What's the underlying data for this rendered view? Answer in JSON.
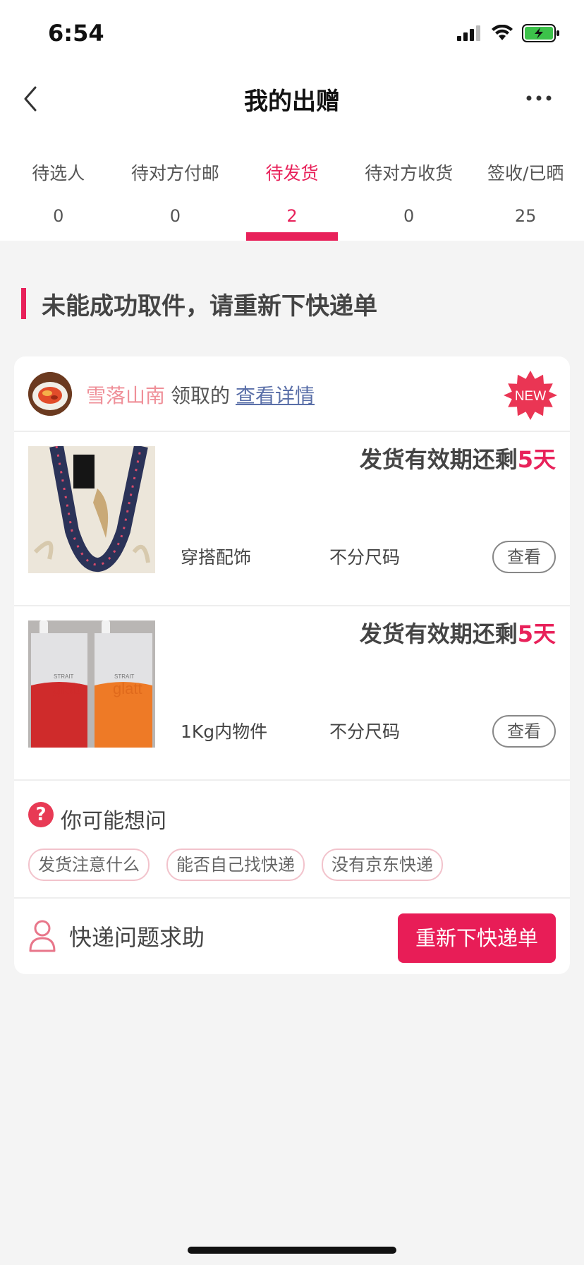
{
  "status_bar": {
    "time": "6:54"
  },
  "header": {
    "title": "我的出赠"
  },
  "tabs": [
    {
      "label": "待选人",
      "count": "0"
    },
    {
      "label": "待对方付邮",
      "count": "0"
    },
    {
      "label": "待发货",
      "count": "2"
    },
    {
      "label": "待对方收货",
      "count": "0"
    },
    {
      "label": "签收/已晒",
      "count": "25"
    }
  ],
  "active_tab_index": 2,
  "notice": {
    "text": "未能成功取件，请重新下快递单"
  },
  "claimer": {
    "name": "雪落山南",
    "action": "领取的",
    "link": "查看详情",
    "badge": "NEW"
  },
  "items": [
    {
      "deadline_prefix": "发货有效期还剩",
      "deadline_value": "5天",
      "category": "穿搭配饰",
      "size": "不分尺码",
      "view_label": "查看"
    },
    {
      "deadline_prefix": "发货有效期还剩",
      "deadline_value": "5天",
      "category": "1Kg内物件",
      "size": "不分尺码",
      "view_label": "查看",
      "image_text": {
        "brand": "glatt",
        "sub": "STRAIT"
      }
    }
  ],
  "faq": {
    "title": "你可能想问",
    "chips": [
      "发货注意什么",
      "能否自己找快递",
      "没有京东快递"
    ]
  },
  "help": {
    "label": "快递问题求助",
    "button": "重新下快递单"
  },
  "colors": {
    "accent": "#e8215a",
    "button": "#e81d57",
    "claimer_name": "#ef8f98",
    "link": "#5a6fa8",
    "background": "#f4f4f4"
  }
}
